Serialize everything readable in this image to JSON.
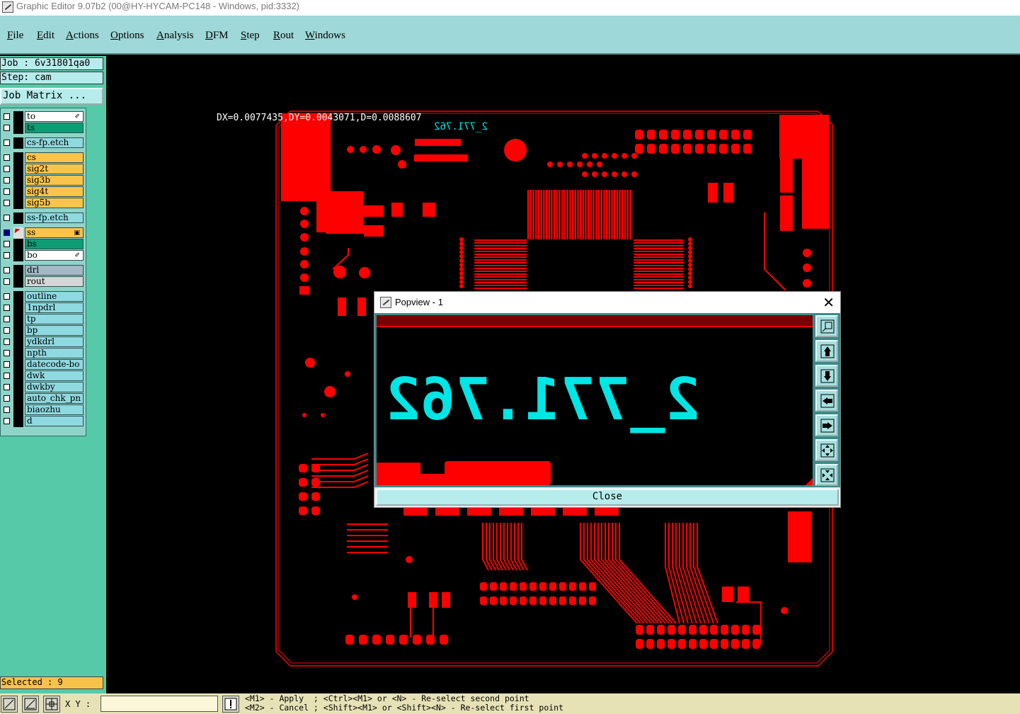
{
  "window": {
    "title": "Graphic Editor 9.07b2 (00@HY-HYCAM-PC148 - Windows, pid:3332)"
  },
  "menu": [
    {
      "label": "File",
      "ul": "F",
      "rest": "ile"
    },
    {
      "label": "Edit",
      "ul": "E",
      "rest": "dit"
    },
    {
      "label": "Actions",
      "ul": "A",
      "rest": "ctions"
    },
    {
      "label": "Options",
      "ul": "O",
      "rest": "ptions"
    },
    {
      "label": "Analysis",
      "ul": "A",
      "rest": "nalysis"
    },
    {
      "label": "DFM",
      "ul": "D",
      "rest": "FM"
    },
    {
      "label": "Step",
      "ul": "S",
      "rest": "tep"
    },
    {
      "label": "Rout",
      "ul": "R",
      "rest": "out"
    },
    {
      "label": "Windows",
      "ul": "W",
      "rest": "indows"
    }
  ],
  "side": {
    "job": "Job : 6v31801qa0",
    "step": "Step: cam",
    "job_matrix": "Job Matrix ...",
    "selected": "Selected : 9"
  },
  "layers": [
    {
      "name": "to",
      "color": "#ffffff",
      "mark": "✐"
    },
    {
      "name": "ts",
      "color": "#0e9c74"
    },
    {
      "name": "cs-fp.etch",
      "color": "#8fd9e0",
      "gap": true
    },
    {
      "name": "cs",
      "color": "#f8c44a",
      "gap": true
    },
    {
      "name": "sig2t",
      "color": "#f8c44a"
    },
    {
      "name": "sig3b",
      "color": "#f8c44a"
    },
    {
      "name": "sig4t",
      "color": "#f8c44a"
    },
    {
      "name": "sig5b",
      "color": "#f8c44a"
    },
    {
      "name": "ss-fp.etch",
      "color": "#8fd9e0",
      "gap": true
    },
    {
      "name": "ss",
      "color": "#f8c44a",
      "gap": true,
      "active": true,
      "mark": "▣"
    },
    {
      "name": "bs",
      "color": "#0e9c74"
    },
    {
      "name": "bo",
      "color": "#ffffff",
      "mark": "✐"
    },
    {
      "name": "drl",
      "color": "#a3b9c6",
      "gap": true
    },
    {
      "name": "rout",
      "color": "#d6d6d6"
    },
    {
      "name": "outline",
      "color": "#8fd9e0",
      "gap": true
    },
    {
      "name": "1npdrl",
      "color": "#8fd9e0"
    },
    {
      "name": "tp",
      "color": "#8fd9e0"
    },
    {
      "name": "bp",
      "color": "#8fd9e0"
    },
    {
      "name": "ydkdrl",
      "color": "#8fd9e0"
    },
    {
      "name": "npth",
      "color": "#8fd9e0"
    },
    {
      "name": "datecode-bo",
      "color": "#8fd9e0"
    },
    {
      "name": "dwk",
      "color": "#8fd9e0"
    },
    {
      "name": "dwkby",
      "color": "#8fd9e0"
    },
    {
      "name": "auto_chk_pn",
      "color": "#8fd9e0"
    },
    {
      "name": "biaozhu",
      "color": "#8fd9e0"
    },
    {
      "name": "d",
      "color": "#8fd9e0"
    }
  ],
  "canvas": {
    "measure": "DX=0.0077435,DY=0.0043071,D=0.0088607",
    "mirrored_text": "2_771.762"
  },
  "popview": {
    "title": "Popview - 1",
    "close_label": "Close",
    "zoom_text": "2_771.762"
  },
  "status": {
    "xy_label": "X Y :",
    "xy_value": "",
    "hint1": "<M1> - Apply  ; <Ctrl><M1> or <N> - Re-select second point",
    "hint2": "<M2> - Cancel ; <Shift><M1> or <Shift><N> - Re-select first point"
  },
  "colors": {
    "pcb": "#ff0000",
    "text": "#00e5e5",
    "panel": "#56c9a8",
    "menubar": "#9ed8d8"
  }
}
